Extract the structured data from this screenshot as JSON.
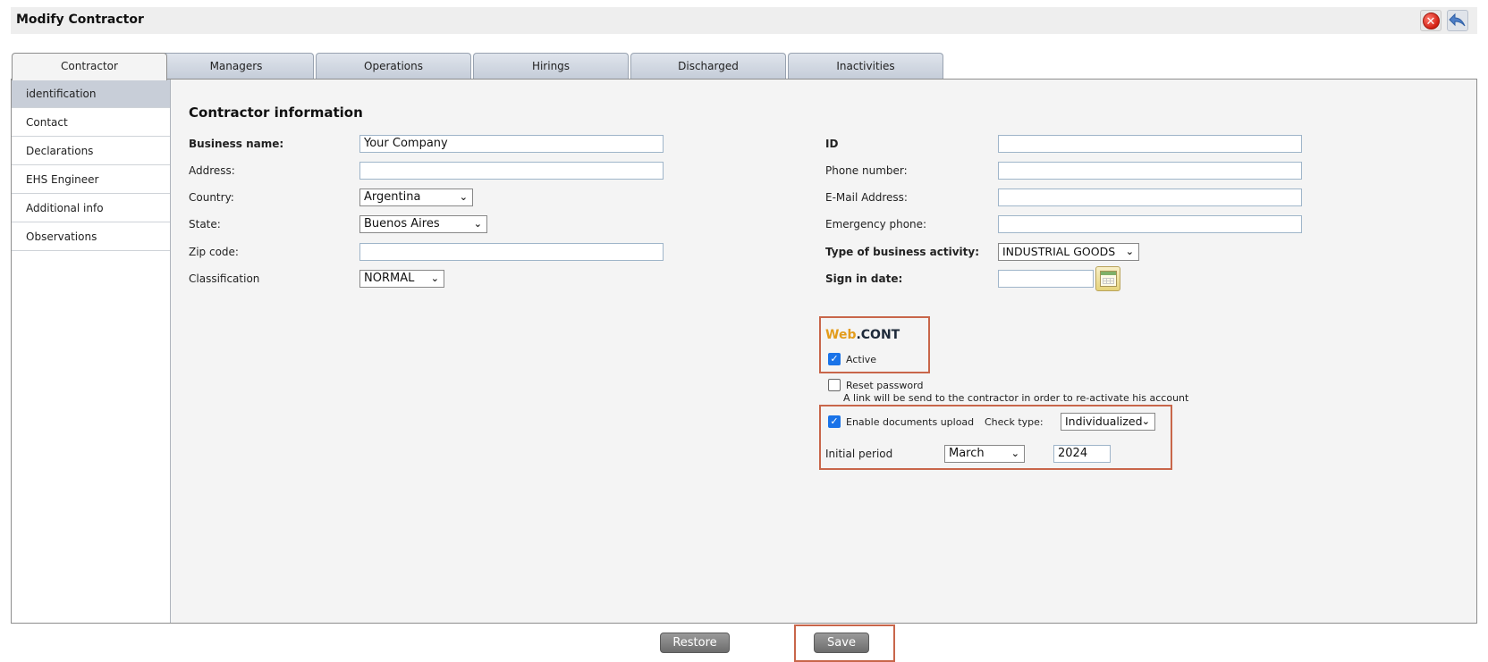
{
  "window": {
    "title": "Modify Contractor"
  },
  "tabs": [
    "Contractor",
    "Managers",
    "Operations",
    "Hirings",
    "Discharged",
    "Inactivities"
  ],
  "sidenav": [
    "identification",
    "Contact",
    "Declarations",
    "EHS Engineer",
    "Additional info",
    "Observations"
  ],
  "form": {
    "section_title": "Contractor information",
    "business_name": {
      "label": "Business name:",
      "value": "Your Company"
    },
    "address": {
      "label": "Address:",
      "value": ""
    },
    "country": {
      "label": "Country:",
      "value": "Argentina"
    },
    "state": {
      "label": "State:",
      "value": "Buenos Aires"
    },
    "zip": {
      "label": "Zip code:",
      "value": ""
    },
    "classification": {
      "label": "Classification",
      "value": "NORMAL"
    },
    "id": {
      "label": "ID",
      "value": ""
    },
    "phone": {
      "label": "Phone number:",
      "value": ""
    },
    "email": {
      "label": "E-Mail Address:",
      "value": ""
    },
    "emergency_phone": {
      "label": "Emergency phone:",
      "value": ""
    },
    "business_activity": {
      "label": "Type of business activity:",
      "value": "INDUSTRIAL GOODS"
    },
    "sign_in_date": {
      "label": "Sign in date:",
      "value": ""
    }
  },
  "webcont": {
    "brand_web": "Web",
    "brand_cont": ".CONT",
    "active_label": "Active",
    "active_checked": true,
    "reset_label": "Reset password",
    "reset_checked": false,
    "reset_hint": "A link will be send to the contractor in order to re-activate his account",
    "upload_label": "Enable documents upload",
    "upload_checked": true,
    "check_type_label": "Check type:",
    "check_type_value": "Individualized",
    "initial_period_label": "Initial period",
    "month": "March",
    "year": "2024"
  },
  "buttons": {
    "restore": "Restore",
    "save": "Save"
  },
  "colors": {
    "highlight_border": "#c8664a",
    "brand_web": "#e39c1b",
    "checkbox": "#1a73e8"
  }
}
